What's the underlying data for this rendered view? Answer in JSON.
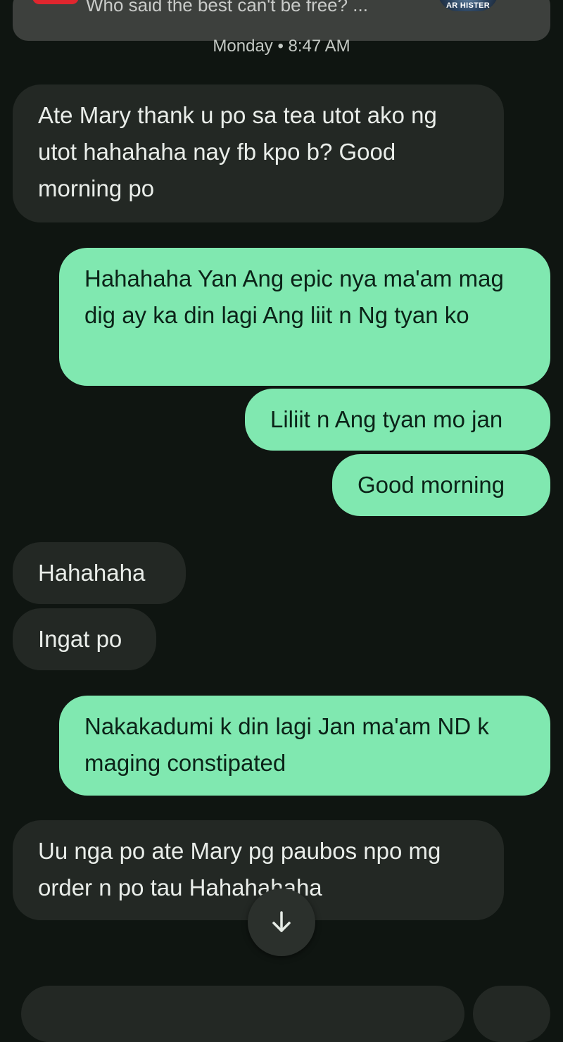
{
  "notification": {
    "text": "Who said the best can't be free? ...",
    "thumbnail_label": "AR HISTER"
  },
  "conversation": {
    "timestamp": "Monday • 8:47 AM",
    "messages": [
      {
        "direction": "incoming",
        "text": "Ate Mary thank u po sa tea utot ako ng utot hahahaha nay fb kpo b? Good morning po"
      },
      {
        "direction": "outgoing",
        "text": "Hahahaha Yan Ang epic nya ma'am mag dig ay ka din lagi Ang liit n Ng tyan ko"
      },
      {
        "direction": "outgoing",
        "text": "Liliit n Ang tyan mo jan"
      },
      {
        "direction": "outgoing",
        "text": "Good morning"
      },
      {
        "direction": "incoming",
        "text": "Hahahaha"
      },
      {
        "direction": "incoming",
        "text": "Ingat po"
      },
      {
        "direction": "outgoing",
        "text": "Nakakadumi k din lagi Jan ma'am ND k maging constipated"
      },
      {
        "direction": "incoming",
        "text": "Uu nga po ate Mary pg paubos npo mg order n po tau Hahahahaha"
      }
    ]
  },
  "icons": {
    "scroll_down": "arrow-down-icon"
  },
  "colors": {
    "background": "#0f1511",
    "incoming_bubble": "#232824",
    "outgoing_bubble": "#80e8b0",
    "outgoing_text": "#0b2318"
  }
}
